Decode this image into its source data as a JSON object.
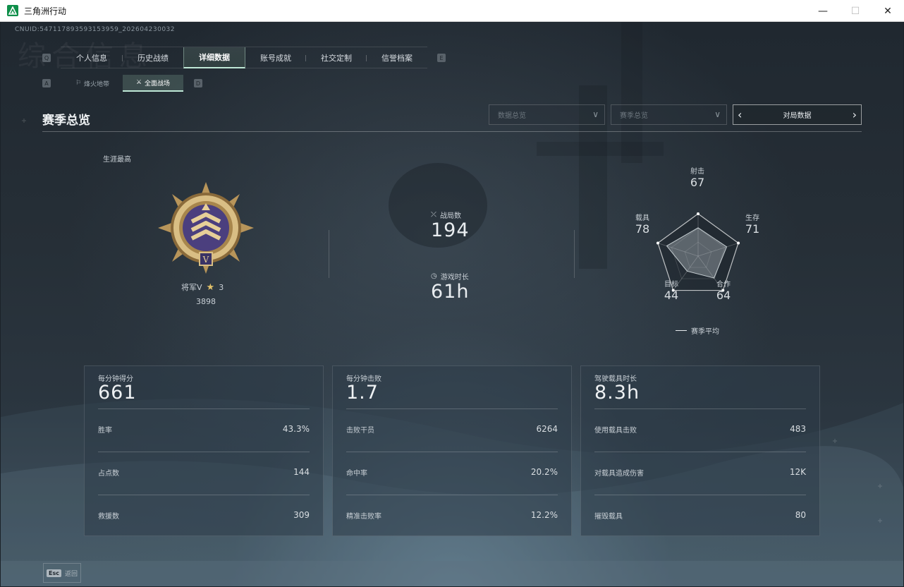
{
  "window": {
    "title": "三角洲行动",
    "minimize": "—",
    "maximize": "☐",
    "close": "✕"
  },
  "uid": "CNUID:547117893593153959_202604230032",
  "ghost_title": "综合信息",
  "keys": {
    "tab_left": "Q",
    "tab_right": "E",
    "sub_left": "A",
    "sub_right": "D",
    "esc": "Esc"
  },
  "tabs": [
    {
      "label": "个人信息"
    },
    {
      "label": "历史战绩"
    },
    {
      "label": "详细数据",
      "active": true
    },
    {
      "label": "账号成就"
    },
    {
      "label": "社交定制"
    },
    {
      "label": "信誉档案"
    }
  ],
  "subtabs": [
    {
      "label": "烽火地带",
      "icon": "flag-icon"
    },
    {
      "label": "全面战场",
      "icon": "battlefield-icon",
      "active": true
    }
  ],
  "section_title": "赛季总览",
  "filters": {
    "data_overview": "数据总览",
    "season_overview": "赛季总览",
    "pager_label": "对局数据"
  },
  "career": {
    "label": "生涯最高",
    "rank_name": "将军V",
    "stars": "3",
    "score": "3898"
  },
  "mid_stats": {
    "matches_label": "战局数",
    "matches_value": "194",
    "playtime_label": "游戏时长",
    "playtime_value": "61h"
  },
  "radar": {
    "axes": [
      {
        "label": "射击",
        "value": 67
      },
      {
        "label": "生存",
        "value": 71
      },
      {
        "label": "合作",
        "value": 64
      },
      {
        "label": "目标",
        "value": 44
      },
      {
        "label": "载具",
        "value": 78
      }
    ],
    "legend": "赛季平均"
  },
  "cards": [
    {
      "title": "每分钟得分",
      "big": "661",
      "rows": [
        {
          "label": "胜率",
          "value": "43.3%"
        },
        {
          "label": "占点数",
          "value": "144"
        },
        {
          "label": "救援数",
          "value": "309"
        }
      ]
    },
    {
      "title": "每分钟击败",
      "big": "1.7",
      "rows": [
        {
          "label": "击败干员",
          "value": "6264"
        },
        {
          "label": "命中率",
          "value": "20.2%"
        },
        {
          "label": "精准击败率",
          "value": "12.2%"
        }
      ]
    },
    {
      "title": "驾驶载具时长",
      "big": "8.3h",
      "rows": [
        {
          "label": "使用载具击败",
          "value": "483"
        },
        {
          "label": "对载具造成伤害",
          "value": "12K"
        },
        {
          "label": "摧毁载具",
          "value": "80"
        }
      ]
    }
  ],
  "bottom": {
    "back_label": "返回"
  },
  "colors": {
    "accent": "#bfe8d6",
    "brand": "#0f8f4a",
    "gold": "#e3c26a"
  }
}
